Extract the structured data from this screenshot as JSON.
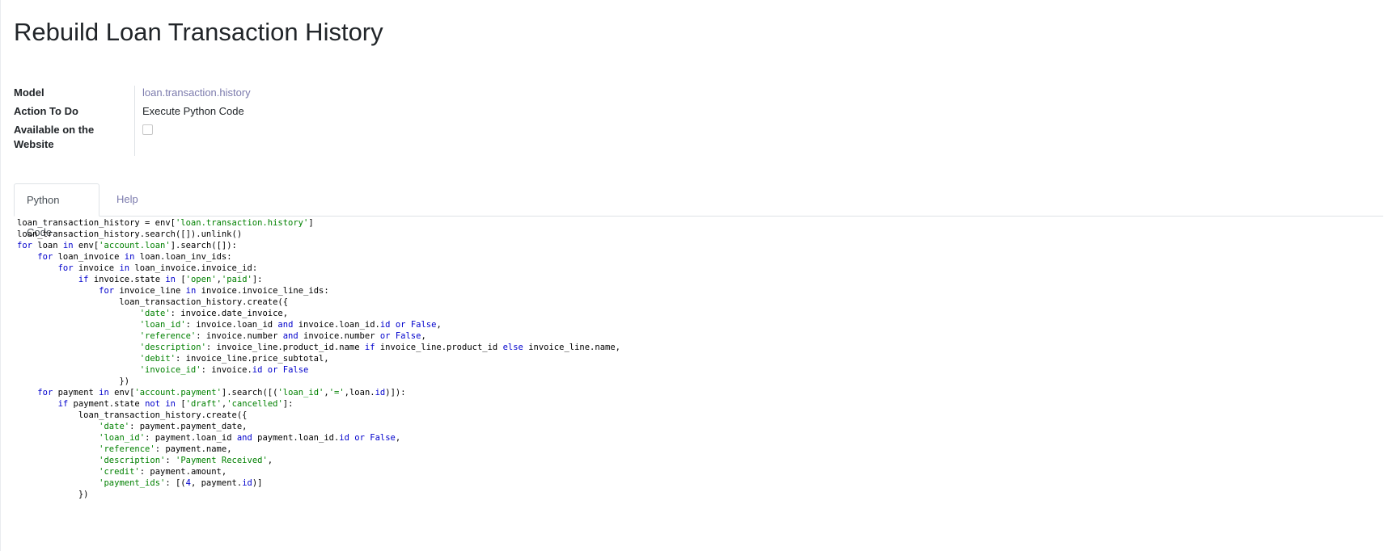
{
  "page_title": "Rebuild Loan Transaction History",
  "fields": {
    "model": {
      "label": "Model",
      "value": "loan.transaction.history"
    },
    "action": {
      "label": "Action To Do",
      "value": "Execute Python Code"
    },
    "website": {
      "label": "Available on the Website",
      "checked": false
    }
  },
  "tabs": {
    "python_code": "Python Code",
    "help": "Help"
  },
  "code_lines": [
    [
      [
        "t",
        "loan_transaction_history = env["
      ],
      [
        "s",
        "'loan.transaction.history'"
      ],
      [
        "t",
        "]"
      ]
    ],
    [
      [
        "t",
        "loan_transaction_history.search([]).unlink()"
      ]
    ],
    [
      [
        "k",
        "for"
      ],
      [
        "t",
        " loan "
      ],
      [
        "k",
        "in"
      ],
      [
        "t",
        " env["
      ],
      [
        "s",
        "'account.loan'"
      ],
      [
        "t",
        "].search([]):"
      ]
    ],
    [
      [
        "t",
        "    "
      ],
      [
        "k",
        "for"
      ],
      [
        "t",
        " loan_invoice "
      ],
      [
        "k",
        "in"
      ],
      [
        "t",
        " loan.loan_inv_ids:"
      ]
    ],
    [
      [
        "t",
        "        "
      ],
      [
        "k",
        "for"
      ],
      [
        "t",
        " invoice "
      ],
      [
        "k",
        "in"
      ],
      [
        "t",
        " loan_invoice.invoice_id:"
      ]
    ],
    [
      [
        "t",
        "            "
      ],
      [
        "k",
        "if"
      ],
      [
        "t",
        " invoice.state "
      ],
      [
        "k",
        "in"
      ],
      [
        "t",
        " ["
      ],
      [
        "s",
        "'open'"
      ],
      [
        "t",
        ","
      ],
      [
        "s",
        "'paid'"
      ],
      [
        "t",
        "]:"
      ]
    ],
    [
      [
        "t",
        "                "
      ],
      [
        "k",
        "for"
      ],
      [
        "t",
        " invoice_line "
      ],
      [
        "k",
        "in"
      ],
      [
        "t",
        " invoice.invoice_line_ids:"
      ]
    ],
    [
      [
        "t",
        "                    loan_transaction_history.create({"
      ]
    ],
    [
      [
        "t",
        "                        "
      ],
      [
        "s",
        "'date'"
      ],
      [
        "t",
        ": invoice.date_invoice,"
      ]
    ],
    [
      [
        "t",
        "                        "
      ],
      [
        "s",
        "'loan_id'"
      ],
      [
        "t",
        ": invoice.loan_id "
      ],
      [
        "k",
        "and"
      ],
      [
        "t",
        " invoice.loan_id."
      ],
      [
        "k",
        "id"
      ],
      [
        "t",
        " "
      ],
      [
        "k",
        "or"
      ],
      [
        "t",
        " "
      ],
      [
        "k",
        "False"
      ],
      [
        "t",
        ","
      ]
    ],
    [
      [
        "t",
        "                        "
      ],
      [
        "s",
        "'reference'"
      ],
      [
        "t",
        ": invoice.number "
      ],
      [
        "k",
        "and"
      ],
      [
        "t",
        " invoice.number "
      ],
      [
        "k",
        "or"
      ],
      [
        "t",
        " "
      ],
      [
        "k",
        "False"
      ],
      [
        "t",
        ","
      ]
    ],
    [
      [
        "t",
        "                        "
      ],
      [
        "s",
        "'description'"
      ],
      [
        "t",
        ": invoice_line.product_id.name "
      ],
      [
        "k",
        "if"
      ],
      [
        "t",
        " invoice_line.product_id "
      ],
      [
        "k",
        "else"
      ],
      [
        "t",
        " invoice_line.name,"
      ]
    ],
    [
      [
        "t",
        "                        "
      ],
      [
        "s",
        "'debit'"
      ],
      [
        "t",
        ": invoice_line.price_subtotal,"
      ]
    ],
    [
      [
        "t",
        "                        "
      ],
      [
        "s",
        "'invoice_id'"
      ],
      [
        "t",
        ": invoice."
      ],
      [
        "k",
        "id"
      ],
      [
        "t",
        " "
      ],
      [
        "k",
        "or"
      ],
      [
        "t",
        " "
      ],
      [
        "k",
        "False"
      ]
    ],
    [
      [
        "t",
        "                    })"
      ]
    ],
    [
      [
        "t",
        "    "
      ],
      [
        "k",
        "for"
      ],
      [
        "t",
        " payment "
      ],
      [
        "k",
        "in"
      ],
      [
        "t",
        " env["
      ],
      [
        "s",
        "'account.payment'"
      ],
      [
        "t",
        "].search([("
      ],
      [
        "s",
        "'loan_id'"
      ],
      [
        "t",
        ","
      ],
      [
        "s",
        "'='"
      ],
      [
        "t",
        ",loan."
      ],
      [
        "k",
        "id"
      ],
      [
        "t",
        ")]):"
      ]
    ],
    [
      [
        "t",
        "        "
      ],
      [
        "k",
        "if"
      ],
      [
        "t",
        " payment.state "
      ],
      [
        "k",
        "not in"
      ],
      [
        "t",
        " ["
      ],
      [
        "s",
        "'draft'"
      ],
      [
        "t",
        ","
      ],
      [
        "s",
        "'cancelled'"
      ],
      [
        "t",
        "]:"
      ]
    ],
    [
      [
        "t",
        "            loan_transaction_history.create({"
      ]
    ],
    [
      [
        "t",
        "                "
      ],
      [
        "s",
        "'date'"
      ],
      [
        "t",
        ": payment.payment_date,"
      ]
    ],
    [
      [
        "t",
        "                "
      ],
      [
        "s",
        "'loan_id'"
      ],
      [
        "t",
        ": payment.loan_id "
      ],
      [
        "k",
        "and"
      ],
      [
        "t",
        " payment.loan_id."
      ],
      [
        "k",
        "id"
      ],
      [
        "t",
        " "
      ],
      [
        "k",
        "or"
      ],
      [
        "t",
        " "
      ],
      [
        "k",
        "False"
      ],
      [
        "t",
        ","
      ]
    ],
    [
      [
        "t",
        "                "
      ],
      [
        "s",
        "'reference'"
      ],
      [
        "t",
        ": payment.name,"
      ]
    ],
    [
      [
        "t",
        "                "
      ],
      [
        "s",
        "'description'"
      ],
      [
        "t",
        ": "
      ],
      [
        "s",
        "'Payment Received'"
      ],
      [
        "t",
        ","
      ]
    ],
    [
      [
        "t",
        "                "
      ],
      [
        "s",
        "'credit'"
      ],
      [
        "t",
        ": payment.amount,"
      ]
    ],
    [
      [
        "t",
        "                "
      ],
      [
        "s",
        "'payment_ids'"
      ],
      [
        "t",
        ": [("
      ],
      [
        "n",
        "4"
      ],
      [
        "t",
        ", payment."
      ],
      [
        "k",
        "id"
      ],
      [
        "t",
        ")]"
      ]
    ],
    [
      [
        "t",
        "            })"
      ]
    ]
  ],
  "colors": {
    "keyword": "#0000cc",
    "string": "#008000",
    "link": "#7c7bad"
  }
}
